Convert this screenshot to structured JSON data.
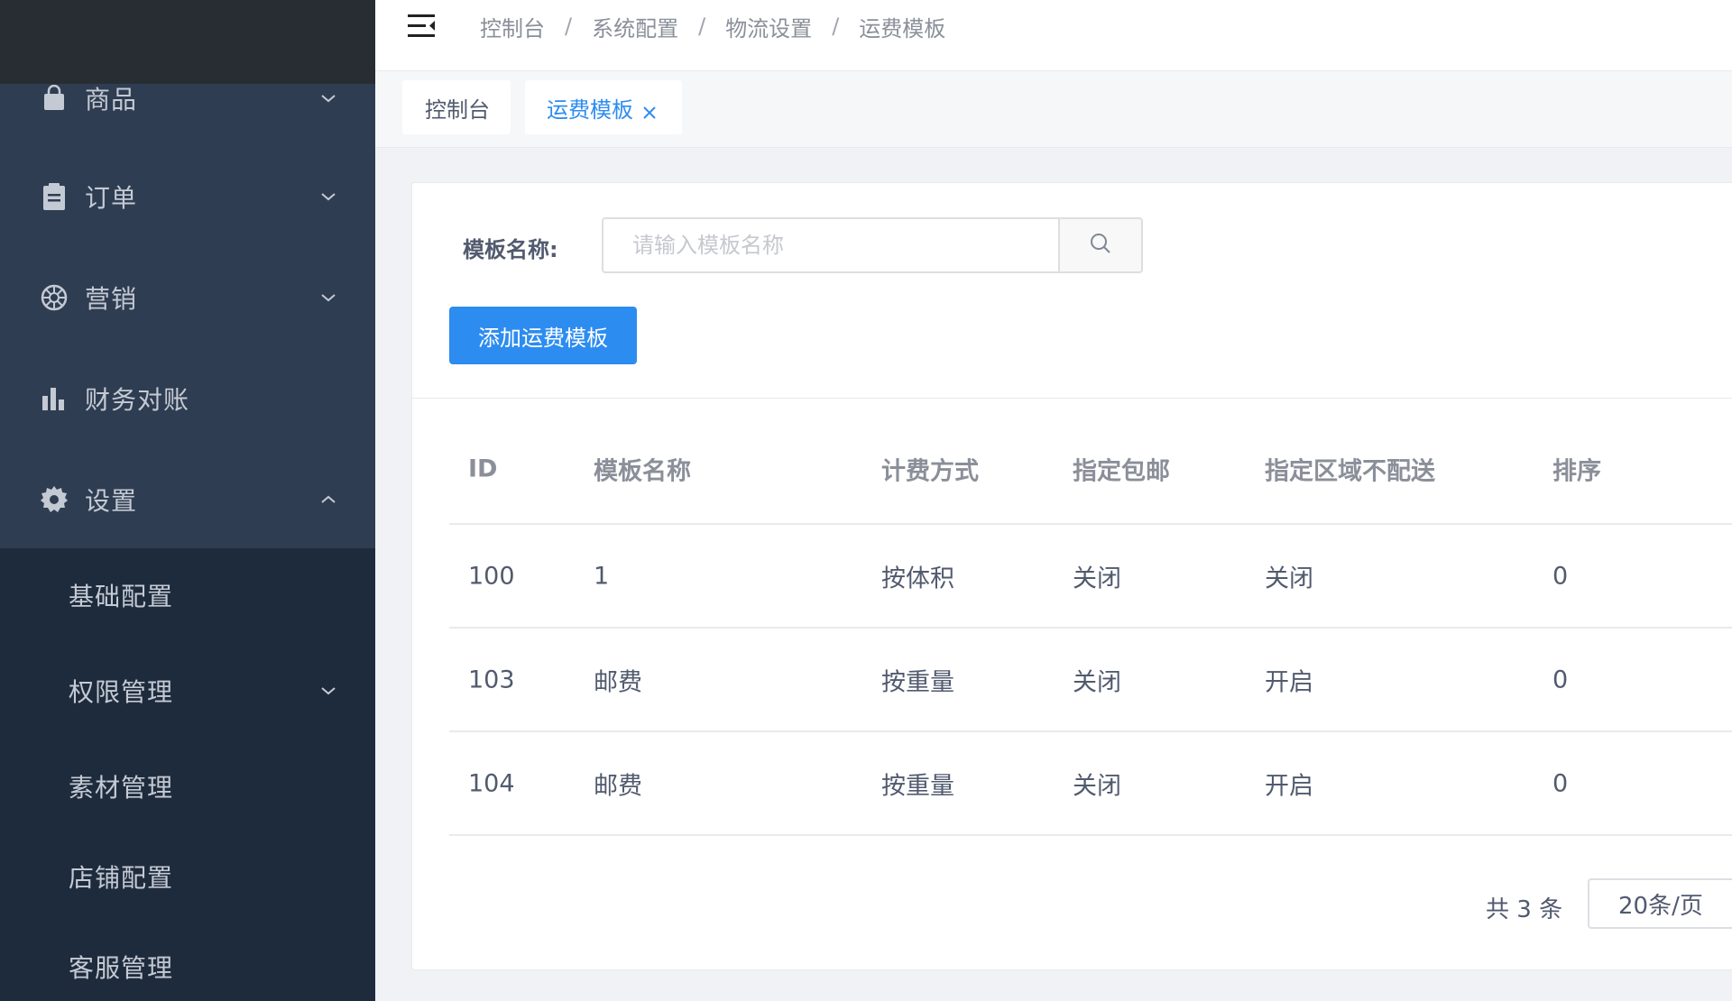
{
  "sidebar": {
    "menu": [
      {
        "label": "商品",
        "icon": "bag-icon"
      },
      {
        "label": "订单",
        "icon": "clipboard-icon"
      },
      {
        "label": "营销",
        "icon": "aperture-icon"
      },
      {
        "label": "财务对账",
        "icon": "bar-chart-icon"
      },
      {
        "label": "设置",
        "icon": "gear-icon"
      }
    ],
    "submenu": [
      {
        "label": "基础配置"
      },
      {
        "label": "权限管理"
      },
      {
        "label": "素材管理"
      },
      {
        "label": "店铺配置"
      },
      {
        "label": "客服管理"
      }
    ]
  },
  "header": {
    "breadcrumb": [
      "控制台",
      "系统配置",
      "物流设置",
      "运费模板"
    ],
    "separator": "/"
  },
  "tabs": [
    {
      "label": "控制台",
      "active": false
    },
    {
      "label": "运费模板",
      "active": true
    }
  ],
  "filter": {
    "label": "模板名称:",
    "placeholder": "请输入模板名称",
    "value": ""
  },
  "actions": {
    "add_label": "添加运费模板"
  },
  "table": {
    "columns": [
      "ID",
      "模板名称",
      "计费方式",
      "指定包邮",
      "指定区域不配送",
      "排序"
    ],
    "rows": [
      [
        "100",
        "1",
        "按体积",
        "关闭",
        "关闭",
        "0"
      ],
      [
        "103",
        "邮费",
        "按重量",
        "关闭",
        "开启",
        "0"
      ],
      [
        "104",
        "邮费",
        "按重量",
        "关闭",
        "开启",
        "0"
      ]
    ]
  },
  "pagination": {
    "total_text": "共 3 条",
    "page_size": "20条/页"
  },
  "colors": {
    "sidebar_bg": "#2f3d52",
    "submenu_bg": "#1e2b3c",
    "accent": "#2d8cf0"
  }
}
